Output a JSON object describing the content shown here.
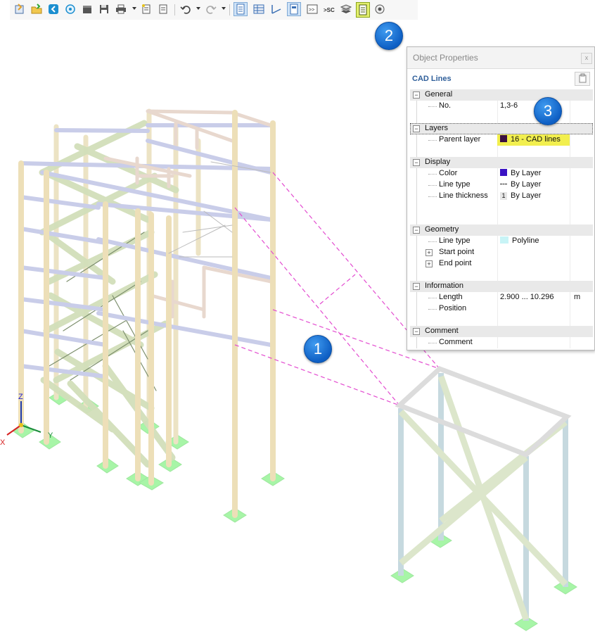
{
  "toolbar": {
    "buttons": [
      {
        "icon": "open-icon"
      },
      {
        "icon": "open-folder-icon"
      },
      {
        "icon": "webservice-icon"
      },
      {
        "icon": "network-icon"
      },
      {
        "icon": "clapper-icon"
      },
      {
        "icon": "save-icon"
      },
      {
        "icon": "print-icon"
      },
      {
        "icon": "report-icon"
      },
      {
        "icon": "page-icon"
      },
      {
        "icon": "undo-icon"
      },
      {
        "icon": "redo-icon"
      },
      {
        "icon": "navigator-icon"
      },
      {
        "icon": "table-icon"
      },
      {
        "icon": "axes-icon"
      },
      {
        "icon": "properties-icon"
      },
      {
        "icon": "console-icon"
      },
      {
        "icon": "script-icon"
      },
      {
        "icon": "layers-icon"
      },
      {
        "icon": "object-properties-icon"
      },
      {
        "icon": "view-icon"
      }
    ]
  },
  "badges": {
    "b1": "1",
    "b2": "2",
    "b3": "3"
  },
  "axes": {
    "x": "X",
    "y": "Y",
    "z": "Z"
  },
  "panel": {
    "title": "Object Properties",
    "close": "x",
    "object_type": "CAD Lines",
    "sections": {
      "general": {
        "title": "General",
        "no_label": "No.",
        "no_value": "1,3-6"
      },
      "layers": {
        "title": "Layers",
        "parent_label": "Parent layer",
        "parent_value": "16 - CAD lines",
        "parent_color": "#3b1040"
      },
      "display": {
        "title": "Display",
        "color_label": "Color",
        "color_value": "By Layer",
        "color_swatch": "#3a12c4",
        "linetype_label": "Line type",
        "linetype_value": "By Layer",
        "thickness_label": "Line thickness",
        "thickness_num": "1",
        "thickness_value": "By Layer"
      },
      "geometry": {
        "title": "Geometry",
        "linetype_label": "Line type",
        "linetype_value": "Polyline",
        "linetype_swatch": "#c8f4f6",
        "start_label": "Start point",
        "end_label": "End point"
      },
      "information": {
        "title": "Information",
        "length_label": "Length",
        "length_value": "2.900 ... 10.296",
        "length_unit": "m",
        "position_label": "Position"
      },
      "comment": {
        "title": "Comment",
        "comment_label": "Comment"
      }
    }
  },
  "colors": {
    "cad_dash": "#e34cd0",
    "column": "#e9dcb8",
    "beam_blue": "#c9cde9",
    "brace_green": "#d2dfba",
    "support": "#a7f5a7",
    "highlight": "#f2ef4e",
    "badge_blue": "#1a70d6"
  }
}
